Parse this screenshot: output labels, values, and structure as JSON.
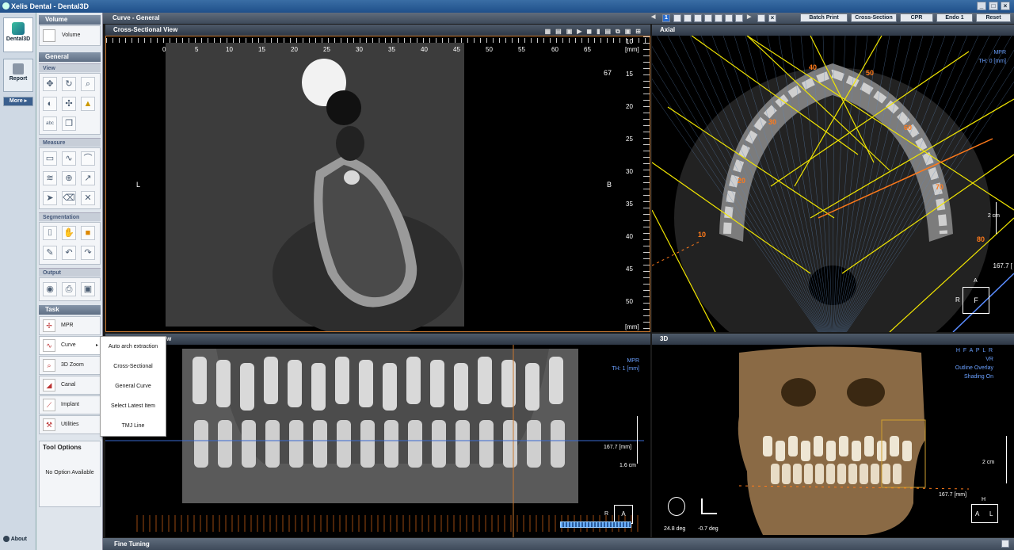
{
  "window": {
    "title": "Xelis Dental - Dental3D"
  },
  "nav": {
    "dental3d": "Dental3D",
    "report": "Report",
    "more": "More",
    "about": "About"
  },
  "sections": {
    "volume": "Volume",
    "general": "General",
    "view": "View",
    "measure": "Measure",
    "segmentation": "Segmentation",
    "output": "Output",
    "task": "Task",
    "tool_options": "Tool Options"
  },
  "volume_button": "Volume",
  "tasks": [
    {
      "label": "MPR",
      "icon": "mpr-icon"
    },
    {
      "label": "Curve",
      "icon": "curve-icon"
    },
    {
      "label": "3D Zoom",
      "icon": "zoom-3d-icon"
    },
    {
      "label": "Canal",
      "icon": "canal-icon"
    },
    {
      "label": "Implant",
      "icon": "implant-icon"
    },
    {
      "label": "Utilities",
      "icon": "utilities-icon"
    }
  ],
  "tool_options_text": "No Option Available",
  "curve_menu": [
    "Auto arch extraction",
    "Cross-Sectional",
    "General Curve",
    "Select Latest Item",
    "TMJ Line"
  ],
  "topbar": {
    "title": "Curve - General",
    "step_active": "1"
  },
  "toolbar_buttons": [
    "Batch Print",
    "Cross-Section",
    "CPR",
    "Endo 1",
    "Reset"
  ],
  "cross_sectional": {
    "title": "Cross-Sectional View",
    "h_ticks": [
      "0",
      "5",
      "10",
      "15",
      "20",
      "25",
      "30",
      "35",
      "40",
      "45",
      "50",
      "55",
      "60",
      "65"
    ],
    "unit": "[mm]",
    "v_ticks": [
      "15",
      "20",
      "25",
      "30",
      "35",
      "40",
      "45",
      "50"
    ],
    "top_tick": "10",
    "number": "67",
    "left": "L",
    "right": "B"
  },
  "axial": {
    "title": "Axial",
    "mpr": "MPR",
    "th": "TH: 0 [mm]",
    "scale": "2 cm",
    "value": "167.7 [",
    "orient_top": "A",
    "orient_left": "R",
    "orient_box": "F",
    "arch_labels": [
      "40",
      "50",
      "30",
      "60",
      "20",
      "70",
      "10",
      "80"
    ]
  },
  "panoramic": {
    "title": "w",
    "mpr": "MPR",
    "th": "TH: 1 [mm]",
    "value": "167.7 [mm]",
    "scale": "1.6 cm",
    "orient_left": "R",
    "orient_box": "A",
    "ruler_labels": [
      "10",
      "20",
      "30",
      "40",
      "50",
      "60",
      "70",
      "80",
      "90"
    ]
  },
  "view3d": {
    "title": "3D",
    "orient": "H F A P L R",
    "vr": "VR",
    "outline": "Outline Overlay",
    "shading": "Shading On",
    "scale": "2 cm",
    "value": "167.7 [mm]",
    "angle1": "24.8 deg",
    "angle2": "-0.7 deg",
    "orient_top": "H",
    "orient_a": "A",
    "orient_l": "L"
  },
  "fine_tuning": "Fine Tuning",
  "colors": {
    "accent_orange": "#ff7a1a",
    "arch_yellow": "#f2e600",
    "overlay_blue": "#5a8cff"
  }
}
